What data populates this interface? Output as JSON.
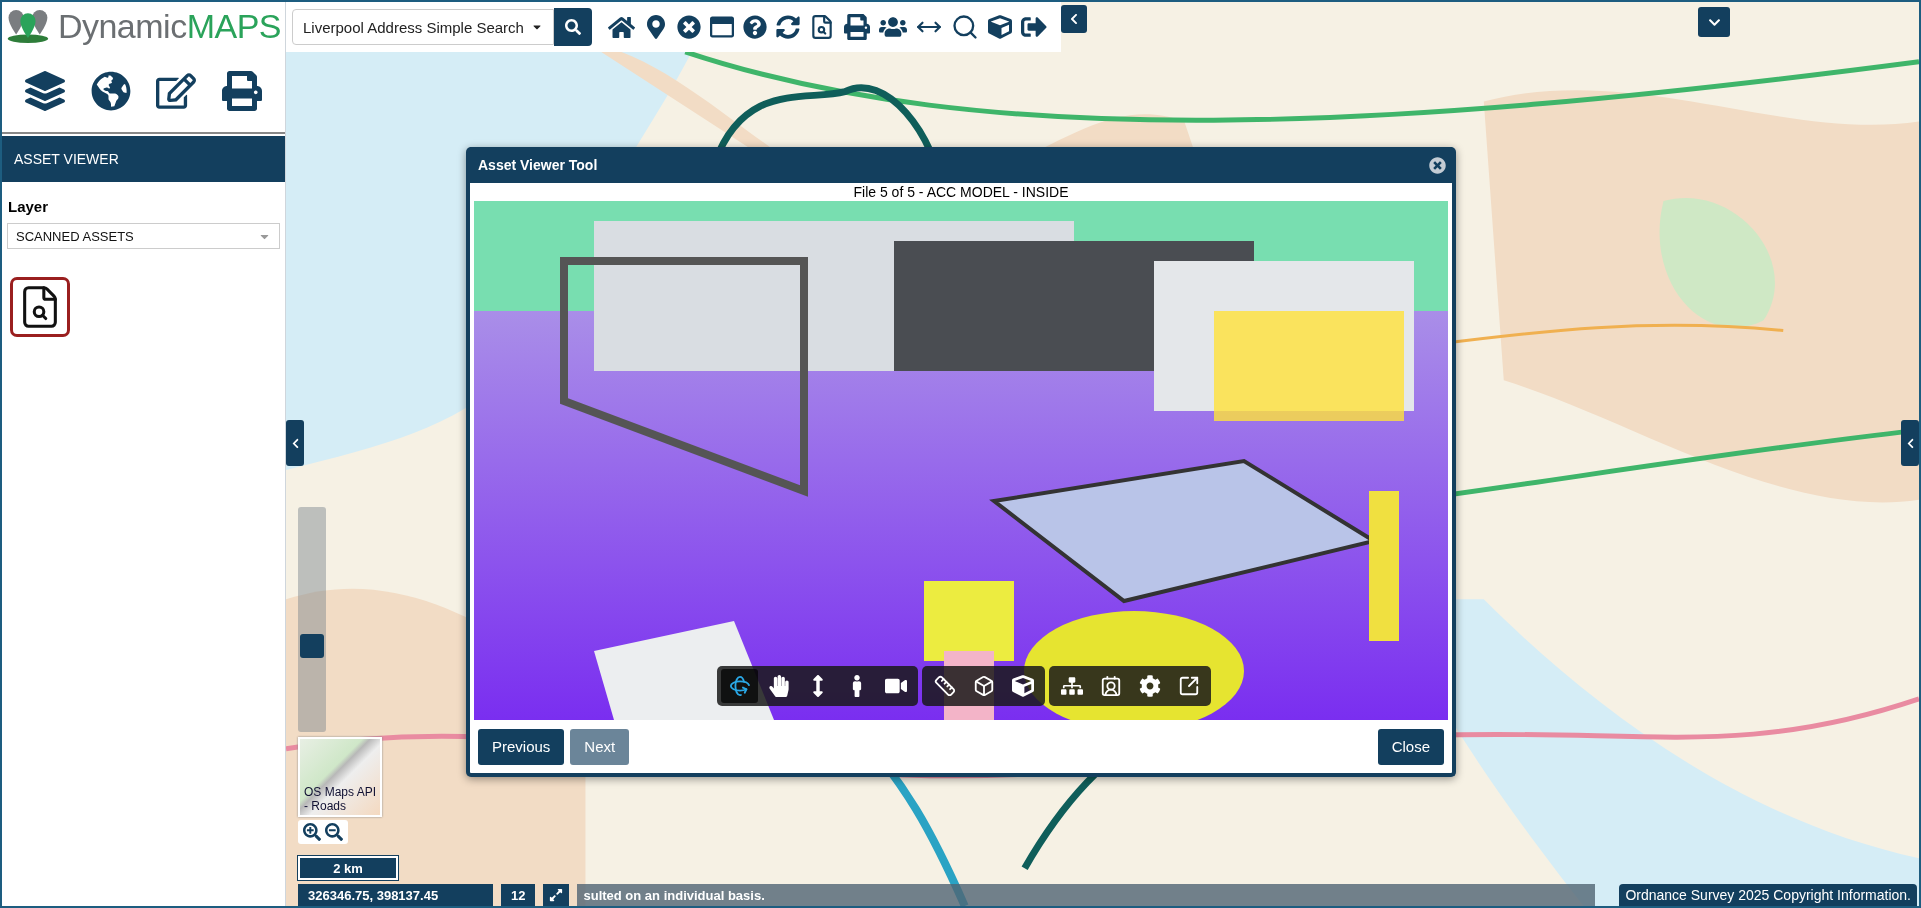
{
  "brand": {
    "name": "Dynamic",
    "accent": "MAPS"
  },
  "search": {
    "value": "Liverpool Address Simple Search"
  },
  "panel": {
    "title": "ASSET VIEWER",
    "layer_label": "Layer",
    "layer_value": "SCANNED ASSETS"
  },
  "map": {
    "zoom_slider": {
      "level": 0.37
    },
    "basemap": "OS Maps API - Roads",
    "scale": "2 km",
    "coordinates": "326346.75, 398137.45",
    "zoom_level": "12",
    "attribution": "sulted on an individual basis.",
    "copyright": "Ordnance Survey 2025 Copyright Information."
  },
  "dialog": {
    "title": "Asset Viewer Tool",
    "caption": "File 5 of 5 - ACC MODEL - INSIDE",
    "tool_groups": [
      [
        {
          "kind": "orbit",
          "selected": true
        },
        {
          "kind": "pan",
          "selected": false
        },
        {
          "kind": "zoom",
          "selected": false
        },
        {
          "kind": "walk",
          "selected": false
        },
        {
          "kind": "camera",
          "selected": false
        }
      ],
      [
        {
          "kind": "measure",
          "selected": false
        },
        {
          "kind": "section",
          "selected": false
        },
        {
          "kind": "explode",
          "selected": false
        }
      ],
      [
        {
          "kind": "tree",
          "selected": false
        },
        {
          "kind": "properties",
          "selected": false
        },
        {
          "kind": "settings",
          "selected": false
        },
        {
          "kind": "fullscreen",
          "selected": false
        }
      ]
    ],
    "buttons": [
      {
        "label": "Previous",
        "disabled": false
      },
      {
        "label": "Next",
        "disabled": true
      }
    ],
    "close": {
      "label": "Close",
      "disabled": false
    }
  }
}
